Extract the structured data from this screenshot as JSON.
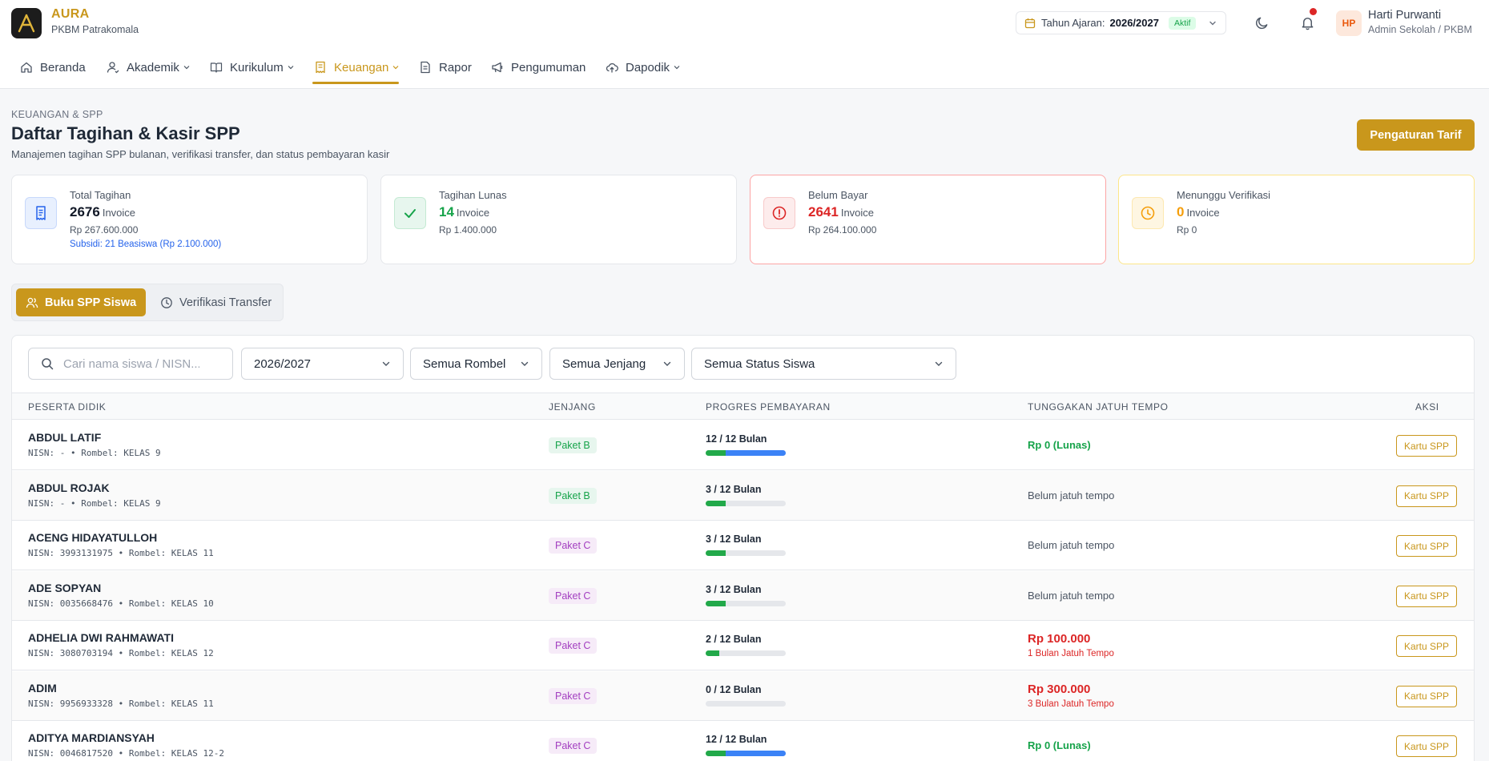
{
  "app": {
    "name": "AURA",
    "org": "PKBM Patrakomala",
    "logo_letter": "A"
  },
  "year": {
    "label": "Tahun Ajaran:",
    "value": "2026/2027",
    "status": "Aktif"
  },
  "user": {
    "initials": "HP",
    "name": "Harti Purwanti",
    "role": "Admin Sekolah / PKBM"
  },
  "nav": [
    {
      "label": "Beranda",
      "icon": "home-icon"
    },
    {
      "label": "Akademik",
      "icon": "user-icon",
      "dropdown": true
    },
    {
      "label": "Kurikulum",
      "icon": "book-icon",
      "dropdown": true
    },
    {
      "label": "Keuangan",
      "icon": "receipt-icon",
      "dropdown": true,
      "active": true
    },
    {
      "label": "Rapor",
      "icon": "document-icon"
    },
    {
      "label": "Pengumuman",
      "icon": "megaphone-icon"
    },
    {
      "label": "Dapodik",
      "icon": "cloud-upload-icon",
      "dropdown": true
    }
  ],
  "page": {
    "breadcrumb": "KEUANGAN & SPP",
    "title": "Daftar Tagihan & Kasir SPP",
    "description": "Manajemen tagihan SPP bulanan, verifikasi transfer, dan status pembayaran kasir",
    "action_label": "Pengaturan Tarif"
  },
  "stats": [
    {
      "label": "Total Tagihan",
      "count": "2676",
      "unit": "Invoice",
      "amount": "Rp 267.600.000",
      "extra": "Subsidi: 21 Beasiswa (Rp 2.100.000)",
      "color": "#2563eb",
      "icon": "receipt-icon"
    },
    {
      "label": "Tagihan Lunas",
      "count": "14",
      "unit": "Invoice",
      "amount": "Rp 1.400.000",
      "color": "#16a34a",
      "icon": "check-icon"
    },
    {
      "label": "Belum Bayar",
      "count": "2641",
      "unit": "Invoice",
      "amount": "Rp 264.100.000",
      "color": "#dc2626",
      "icon": "alert-circle-icon"
    },
    {
      "label": "Menunggu Verifikasi",
      "count": "0",
      "unit": "Invoice",
      "amount": "Rp 0",
      "color": "#f59e0b",
      "icon": "clock-icon"
    }
  ],
  "tabs": [
    {
      "label": "Buku SPP Siswa",
      "icon": "users-icon",
      "active": true
    },
    {
      "label": "Verifikasi Transfer",
      "icon": "clock-icon"
    }
  ],
  "filters": {
    "search_placeholder": "Cari nama siswa / NISN...",
    "year": "2026/2027",
    "rombel": "Semua Rombel",
    "jenjang": "Semua Jenjang",
    "status": "Semua Status Siswa"
  },
  "table": {
    "columns": [
      "PESERTA DIDIK",
      "JENJANG",
      "PROGRES PEMBAYARAN",
      "TUNGGAKAN JATUH TEMPO",
      "AKSI"
    ],
    "action_label": "Kartu SPP",
    "rows": [
      {
        "name": "ABDUL LATIF",
        "meta": "NISN: - • Rombel: KELAS 9",
        "jenjang": "Paket B",
        "paid": 12,
        "total": 12,
        "progress": "12 / 12 Bulan",
        "due_type": "ok",
        "due": "Rp 0 (Lunas)",
        "due_sub": ""
      },
      {
        "name": "ABDUL ROJAK",
        "meta": "NISN: - • Rombel: KELAS 9",
        "jenjang": "Paket B",
        "paid": 3,
        "total": 12,
        "progress": "3 / 12 Bulan",
        "due_type": "none",
        "due": "Belum jatuh tempo",
        "due_sub": ""
      },
      {
        "name": "ACENG HIDAYATULLOH",
        "meta": "NISN: 3993131975 • Rombel: KELAS 11",
        "jenjang": "Paket C",
        "paid": 3,
        "total": 12,
        "progress": "3 / 12 Bulan",
        "due_type": "none",
        "due": "Belum jatuh tempo",
        "due_sub": ""
      },
      {
        "name": "ADE SOPYAN",
        "meta": "NISN: 0035668476 • Rombel: KELAS 10",
        "jenjang": "Paket C",
        "paid": 3,
        "total": 12,
        "progress": "3 / 12 Bulan",
        "due_type": "none",
        "due": "Belum jatuh tempo",
        "due_sub": ""
      },
      {
        "name": "ADHELIA DWI RAHMAWATI",
        "meta": "NISN: 3080703194 • Rombel: KELAS 12",
        "jenjang": "Paket C",
        "paid": 2,
        "total": 12,
        "progress": "2 / 12 Bulan",
        "due_type": "late",
        "due": "Rp 100.000",
        "due_sub": "1 Bulan Jatuh Tempo"
      },
      {
        "name": "ADIM",
        "meta": "NISN: 9956933328 • Rombel: KELAS 11",
        "jenjang": "Paket C",
        "paid": 0,
        "total": 12,
        "progress": "0 / 12 Bulan",
        "due_type": "late",
        "due": "Rp 300.000",
        "due_sub": "3 Bulan Jatuh Tempo"
      },
      {
        "name": "ADITYA MARDIANSYAH",
        "meta": "NISN: 0046817520 • Rombel: KELAS 12-2",
        "jenjang": "Paket C",
        "paid": 12,
        "total": 12,
        "progress": "12 / 12 Bulan",
        "due_type": "ok",
        "due": "Rp 0 (Lunas)",
        "due_sub": ""
      }
    ]
  },
  "colors": {
    "accent": "#c9971c",
    "paid_green": "#22a94a",
    "prepaid_blue": "#3b82f6",
    "danger": "#dc2626"
  }
}
